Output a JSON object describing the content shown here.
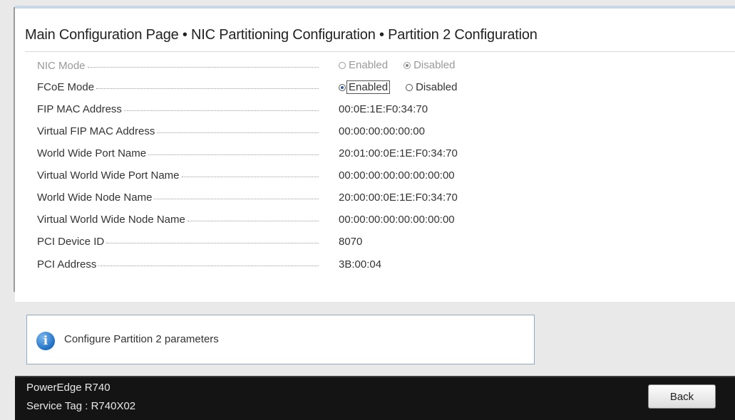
{
  "page": {
    "title": "Main Configuration Page • NIC Partitioning Configuration • Partition 2 Configuration"
  },
  "settings": [
    {
      "label": "NIC Mode",
      "type": "radio",
      "disabled": true,
      "options": [
        "Enabled",
        "Disabled"
      ],
      "selected": "Disabled"
    },
    {
      "label": "FCoE Mode",
      "type": "radio",
      "disabled": false,
      "options": [
        "Enabled",
        "Disabled"
      ],
      "selected": "Enabled"
    },
    {
      "label": "FIP MAC Address",
      "type": "text",
      "value": "00:0E:1E:F0:34:70"
    },
    {
      "label": "Virtual FIP MAC Address",
      "type": "text",
      "value": "00:00:00:00:00:00"
    },
    {
      "label": "World Wide Port Name",
      "type": "text",
      "value": "20:01:00:0E:1E:F0:34:70"
    },
    {
      "label": "Virtual World Wide Port Name",
      "type": "text",
      "value": "00:00:00:00:00:00:00:00"
    },
    {
      "label": "World Wide Node Name",
      "type": "text",
      "value": "20:00:00:0E:1E:F0:34:70"
    },
    {
      "label": "Virtual World Wide Node Name",
      "type": "text",
      "value": "00:00:00:00:00:00:00:00"
    },
    {
      "label": "PCI Device ID",
      "type": "text",
      "value": "8070"
    },
    {
      "label": "PCI Address",
      "type": "text",
      "value": "3B:00:04"
    }
  ],
  "help": {
    "icon": "info-icon",
    "text": "Configure Partition 2 parameters"
  },
  "footer": {
    "model": "PowerEdge R740",
    "service_tag": "Service Tag : R740X02",
    "back_label": "Back"
  },
  "colors": {
    "accent": "#2a5aa0",
    "footer_bg": "#141414",
    "info_icon": "#1f6fc4"
  }
}
